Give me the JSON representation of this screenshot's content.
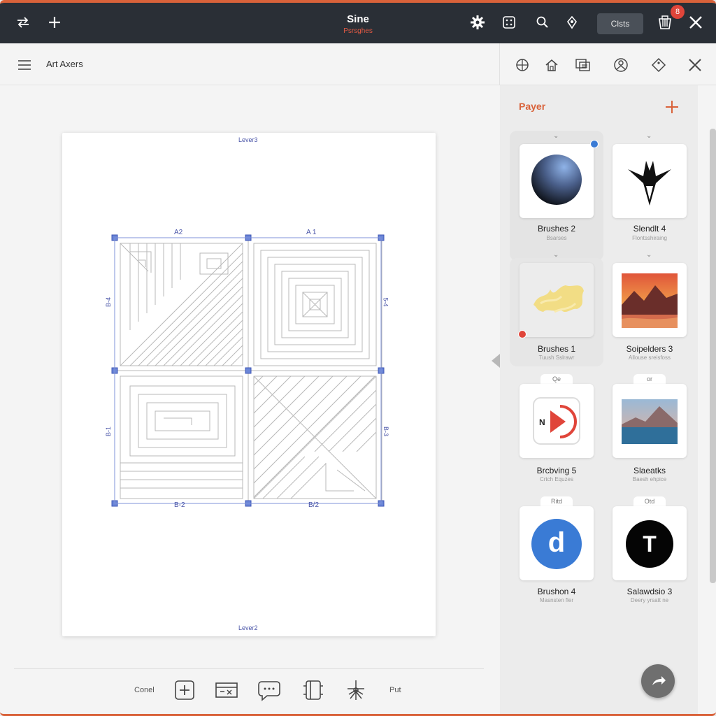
{
  "titlebar": {
    "title": "Sine",
    "subtitle": "Psrsghes",
    "action_button": "Clsts",
    "badge": "8",
    "icons": [
      "swap-icon",
      "plus-icon",
      "gear-icon",
      "grid-icon",
      "search-icon",
      "tip-icon",
      "bucket-icon",
      "close-icon"
    ]
  },
  "subbar": {
    "doc_title": "Art Axers",
    "menu_icon": "menu-icon"
  },
  "canvas": {
    "top_label": "Lever3",
    "bottom_label": "Lever2",
    "markers": {
      "top_left": "A2",
      "top_right": "A 1",
      "bottom_left": "B-2",
      "bottom_right": "B/2",
      "left_upper": "B-4",
      "left_lower": "B-1",
      "right_upper": "5-4",
      "right_lower": "B-3"
    }
  },
  "bottom_toolbar": {
    "left_text": "Conel",
    "right_text": "Put",
    "icons": [
      "add-box-icon",
      "transform-icon",
      "chat-icon",
      "frame-icon",
      "anchor-icon"
    ]
  },
  "right_toolbar": {
    "icons": [
      "globe-icon",
      "home-icon",
      "layers-icon",
      "person-icon",
      "tag-icon",
      "close-icon"
    ]
  },
  "panel": {
    "heading": "Payer",
    "add_icon": "plus-icon",
    "items": [
      {
        "name": "Brushes 2",
        "sub": "Bsarses",
        "icon": "sphere-icon",
        "tab": ""
      },
      {
        "name": "Slendlt 4",
        "sub": "Flontsshiraing",
        "icon": "tribal-icon",
        "tab": ""
      },
      {
        "name": "Brushes 1",
        "sub": "Tuush Sslrawr",
        "icon": "paint-stroke-icon",
        "tab": ""
      },
      {
        "name": "Soipelders 3",
        "sub": "Allouse sreisfoss",
        "icon": "sunset-image-icon",
        "tab": ""
      },
      {
        "name": "Brcbving 5",
        "sub": "Crtch Equzes",
        "icon": "play-icon",
        "tab": "Qe"
      },
      {
        "name": "Slaeatks",
        "sub": "Baesh ehpice",
        "icon": "mountain-image-icon",
        "tab": "or"
      },
      {
        "name": "Brushon 4",
        "sub": "Masnsten fler",
        "icon": "d-logo-icon",
        "tab": "Ritd"
      },
      {
        "name": "Salawdsio 3",
        "sub": "Deery yrsatt ne",
        "icon": "t-logo-icon",
        "tab": "Otd"
      }
    ],
    "play_letter": "N",
    "d_letter": "d",
    "t_letter": "T"
  },
  "colors": {
    "accent": "#d9623a",
    "titlebar": "#2a2f36",
    "badge": "#e0453a",
    "blue": "#3a7bd5"
  }
}
